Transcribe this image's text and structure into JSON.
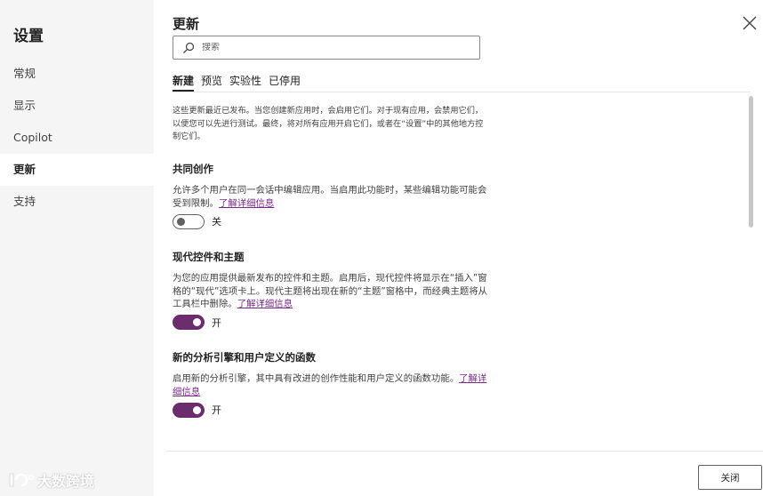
{
  "sidebar": {
    "title": "设置",
    "items": [
      {
        "label": "常规",
        "active": false
      },
      {
        "label": "显示",
        "active": false
      },
      {
        "label": "Copilot",
        "active": false
      },
      {
        "label": "更新",
        "active": true
      },
      {
        "label": "支持",
        "active": false
      }
    ]
  },
  "watermark": {
    "text": "大数跨境"
  },
  "panel": {
    "title": "更新",
    "search": {
      "placeholder": "搜索",
      "value": ""
    },
    "tabs": [
      {
        "label": "新建",
        "active": true
      },
      {
        "label": "预览",
        "active": false
      },
      {
        "label": "实验性",
        "active": false
      },
      {
        "label": "已停用",
        "active": false
      }
    ],
    "intro": "这些更新最近已发布。当您创建新应用时，会启用它们。对于现有应用，会禁用它们，以便您可以先进行测试。最终，将对所有应用开启它们，或者在“设置”中的其他地方控制它们。",
    "sections": [
      {
        "title": "共同创作",
        "description": "允许多个用户在同一会话中编辑应用。当启用此功能时，某些编辑功能可能会受到限制。",
        "link": "了解详细信息",
        "toggle_on": false,
        "toggle_label": "关"
      },
      {
        "title": "现代控件和主题",
        "description": "为您的应用提供最新发布的控件和主题。启用后，现代控件将显示在“插入”窗格的“现代”选项卡上。现代主题将出现在新的“主题”窗格中，而经典主题将从工具栏中删除。",
        "link": "了解详细信息",
        "toggle_on": true,
        "toggle_label": "开"
      },
      {
        "title": "新的分析引擎和用户定义的函数",
        "description": "启用新的分析引擎，其中具有改进的创作性能和用户定义的函数功能。",
        "link": "了解详细信息",
        "toggle_on": true,
        "toggle_label": "开"
      }
    ],
    "close_button_label": "关闭"
  },
  "colors": {
    "accent": "#6b2d6e",
    "link": "#7a2b8a",
    "sidebar_bg": "#f5f5f5"
  }
}
